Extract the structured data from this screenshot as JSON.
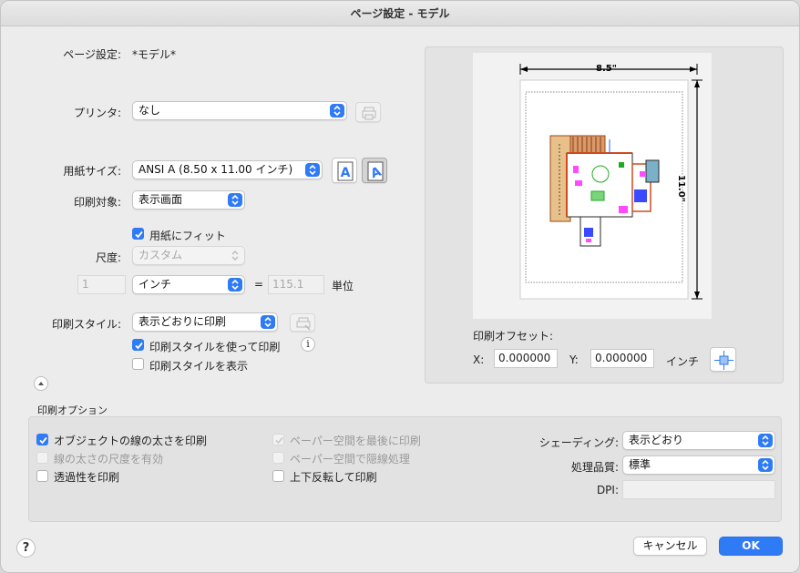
{
  "window": {
    "title": "ページ設定 - モデル"
  },
  "page_setup": {
    "label": "ページ設定:",
    "value": "*モデル*"
  },
  "printer": {
    "label": "プリンタ:",
    "value": "なし"
  },
  "paper": {
    "label": "用紙サイズ:",
    "value": "ANSI A (8.50 x 11.00 インチ)",
    "orientation_portrait_icon": "portrait-a-icon",
    "orientation_landscape_icon": "landscape-a-icon"
  },
  "plot_area": {
    "label": "印刷対象:",
    "value": "表示画面"
  },
  "fit": {
    "label": "用紙にフィット",
    "checked": true
  },
  "scale": {
    "label": "尺度:",
    "value": "カスタム",
    "left_value": "1",
    "unit": "インチ",
    "equals": "=",
    "right_value": "115.1",
    "right_unit": "単位"
  },
  "plot_style": {
    "label": "印刷スタイル:",
    "value": "表示どおりに印刷",
    "use_label": "印刷スタイルを使って印刷",
    "use_checked": true,
    "show_label": "印刷スタイルを表示",
    "show_checked": false,
    "info_icon": "i"
  },
  "preview": {
    "width_label": "8.5\"",
    "height_label": "11.0\""
  },
  "offset": {
    "title": "印刷オフセット:",
    "x_label": "X:",
    "x_value": "0.000000",
    "y_label": "Y:",
    "y_value": "0.000000",
    "unit": "インチ"
  },
  "options": {
    "title": "印刷オプション",
    "col1": [
      {
        "label": "オブジェクトの線の太さを印刷",
        "checked": true,
        "enabled": true
      },
      {
        "label": "線の太さの尺度を有効",
        "checked": false,
        "enabled": false
      },
      {
        "label": "透過性を印刷",
        "checked": false,
        "enabled": true
      }
    ],
    "col2": [
      {
        "label": "ペーパー空間を最後に印刷",
        "checked": true,
        "enabled": false
      },
      {
        "label": "ペーパー空間で隠線処理",
        "checked": false,
        "enabled": false
      },
      {
        "label": "上下反転して印刷",
        "checked": false,
        "enabled": true
      }
    ],
    "shading": {
      "label": "シェーディング:",
      "value": "表示どおり"
    },
    "quality": {
      "label": "処理品質:",
      "value": "標準"
    },
    "dpi": {
      "label": "DPI:",
      "value": ""
    }
  },
  "footer": {
    "help": "?",
    "cancel": "キャンセル",
    "ok": "OK"
  },
  "colors": {
    "accent": "#2f7bf5"
  }
}
